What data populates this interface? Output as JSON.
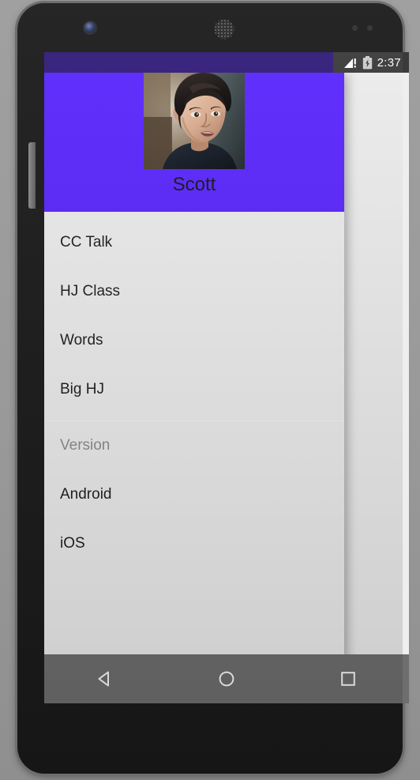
{
  "device": {
    "front_camera_icon": "front-camera-icon",
    "earpiece_icon": "earpiece-speaker-icon",
    "sensor_icon": "proximity-sensor-icon",
    "side_button_icon": "volume-button-icon"
  },
  "status_bar": {
    "signal_icon": "signal-no-sim-icon",
    "battery_icon": "battery-charging-icon",
    "clock": "2:37"
  },
  "drawer": {
    "header": {
      "avatar_icon": "user-avatar-photo",
      "name": "Scott",
      "background_color": "#5a26ff"
    },
    "primary_items": [
      {
        "label": "CC Talk"
      },
      {
        "label": "HJ Class"
      },
      {
        "label": "Words"
      },
      {
        "label": "Big HJ"
      }
    ],
    "secondary_section": {
      "header": "Version",
      "items": [
        {
          "label": "Android"
        },
        {
          "label": "iOS"
        }
      ]
    }
  },
  "nav_bar": {
    "back_icon": "back-triangle-icon",
    "home_icon": "home-circle-icon",
    "recents_icon": "recents-square-icon",
    "background_color": "#6e6e6e"
  }
}
